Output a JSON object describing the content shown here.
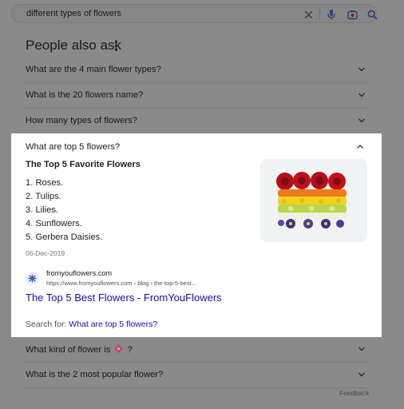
{
  "search": {
    "query": "different types of flowers",
    "icons": [
      "clear-icon",
      "mic-icon",
      "lens-icon",
      "search-icon"
    ]
  },
  "paa": {
    "title": "People also ask",
    "questions_before": [
      "What are the 4 main flower types?",
      "What is the 20 flowers name?",
      "How many types of flowers?"
    ],
    "expanded": {
      "question": "What are top 5 flowers?",
      "answer_title": "The Top 5 Favorite Flowers",
      "list": [
        "1. Roses.",
        "2. Tulips.",
        "3. Lilies.",
        "4. Sunflowers.",
        "5. Gerbera Daisies."
      ],
      "date": "06-Dec-2019",
      "source_site": "fromyouflowers.com",
      "source_url": "https://www.fromyouflowers.com › blog › the-top-5-best...",
      "result_title": "The Top 5 Best Flowers - FromYouFlowers",
      "search_for_label": "Search for:",
      "search_for_link": "What are top 5 flowers?"
    },
    "questions_after": [
      {
        "text": "What kind of flower is",
        "suffix": "?",
        "icon": "flower-emoji-icon"
      },
      {
        "text": "What is the 2 most popular flower?",
        "suffix": ""
      }
    ],
    "feedback": "Feedback"
  },
  "colors": {
    "link": "#1a0dab",
    "overlay": "#8a8a8a",
    "panel": "#ffffff"
  }
}
